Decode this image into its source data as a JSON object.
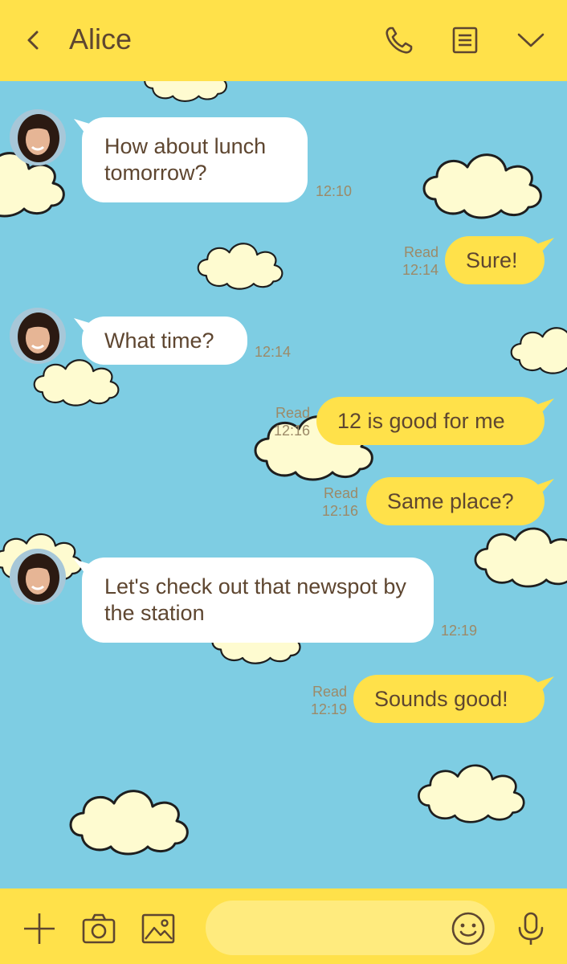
{
  "header": {
    "title": "Alice",
    "back_icon": "chevron-left-icon",
    "call_icon": "phone-icon",
    "menu_icon": "document-icon",
    "more_icon": "chevron-down-icon"
  },
  "colors": {
    "header_bg": "#ffe14a",
    "chat_bg": "#7ecde3",
    "incoming_bubble": "#ffffff",
    "outgoing_bubble": "#ffe14a",
    "text": "#5e4630",
    "meta_text": "#9c8a68",
    "cloud_fill": "#fefbd0",
    "cloud_stroke": "#1e1e1e"
  },
  "messages": [
    {
      "from": "Alice",
      "direction": "in",
      "text": "How about lunch tomorrow?",
      "time": "12:10"
    },
    {
      "direction": "out",
      "text": "Sure!",
      "status": "Read",
      "time": "12:14"
    },
    {
      "from": "Alice",
      "direction": "in",
      "text": "What time?",
      "time": "12:14"
    },
    {
      "direction": "out",
      "text": "12 is good for me",
      "status": "Read",
      "time": "12:16"
    },
    {
      "direction": "out",
      "text": "Same place?",
      "status": "Read",
      "time": "12:16"
    },
    {
      "from": "Alice",
      "direction": "in",
      "text": "Let's check out that newspot by the station",
      "time": "12:19"
    },
    {
      "direction": "out",
      "text": "Sounds good!",
      "status": "Read",
      "time": "12:19"
    }
  ],
  "composer": {
    "add_icon": "plus-icon",
    "camera_icon": "camera-icon",
    "gallery_icon": "image-icon",
    "input_value": "",
    "emoji_icon": "smiley-icon",
    "mic_icon": "microphone-icon"
  }
}
